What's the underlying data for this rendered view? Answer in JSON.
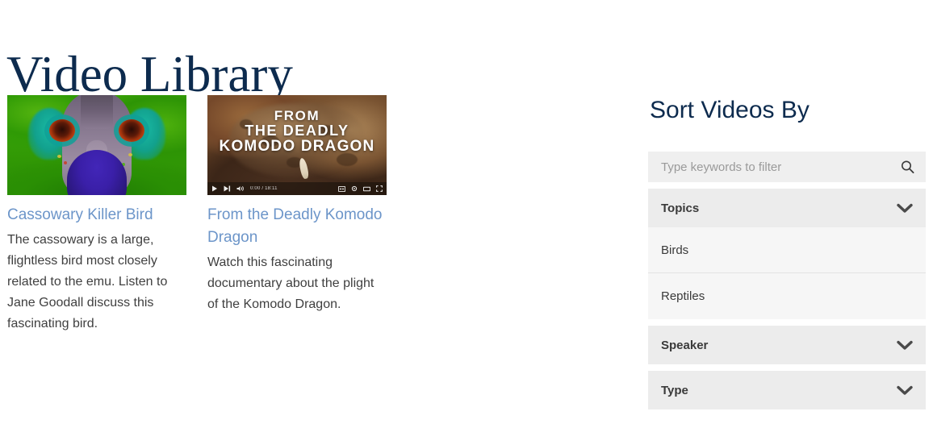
{
  "page": {
    "title": "Video Library",
    "title_color": "#0d2b4e"
  },
  "videos": [
    {
      "thumbnail_kind": "cassowary-photo",
      "title": "Cassowary Killer Bird",
      "description": "The cassowary is a large, flightless bird most closely related to the emu. Listen to Jane Goodall discuss this fascinating bird.",
      "link_color": "#6c95c9"
    },
    {
      "thumbnail_kind": "komodo-video",
      "overlay_title_lines": [
        "FROM",
        "THE DEADLY",
        "KOMODO DRAGON"
      ],
      "player": {
        "play_icon": "play-icon",
        "next_icon": "next-track-icon",
        "volume_icon": "volume-icon",
        "time": "0:00 / 18:11",
        "captions_icon": "captions-icon",
        "settings_icon": "settings-gear-icon",
        "theater_icon": "theater-mode-icon",
        "fullscreen_icon": "fullscreen-icon"
      },
      "title": "From the Deadly Komodo Dragon",
      "description": "Watch this fascinating documentary about the plight of the Komodo Dragon.",
      "link_color": "#6c95c9"
    }
  ],
  "sidebar": {
    "heading": "Sort Videos By",
    "search": {
      "placeholder": "Type keywords to filter",
      "value": "",
      "icon": "search-icon"
    },
    "groups": [
      {
        "label": "Topics",
        "expanded": true,
        "chevron": "chevron-down-icon",
        "items": [
          "Birds",
          "Reptiles"
        ]
      },
      {
        "label": "Speaker",
        "expanded": false,
        "chevron": "chevron-down-icon",
        "items": []
      },
      {
        "label": "Type",
        "expanded": false,
        "chevron": "chevron-down-icon",
        "items": []
      }
    ]
  }
}
